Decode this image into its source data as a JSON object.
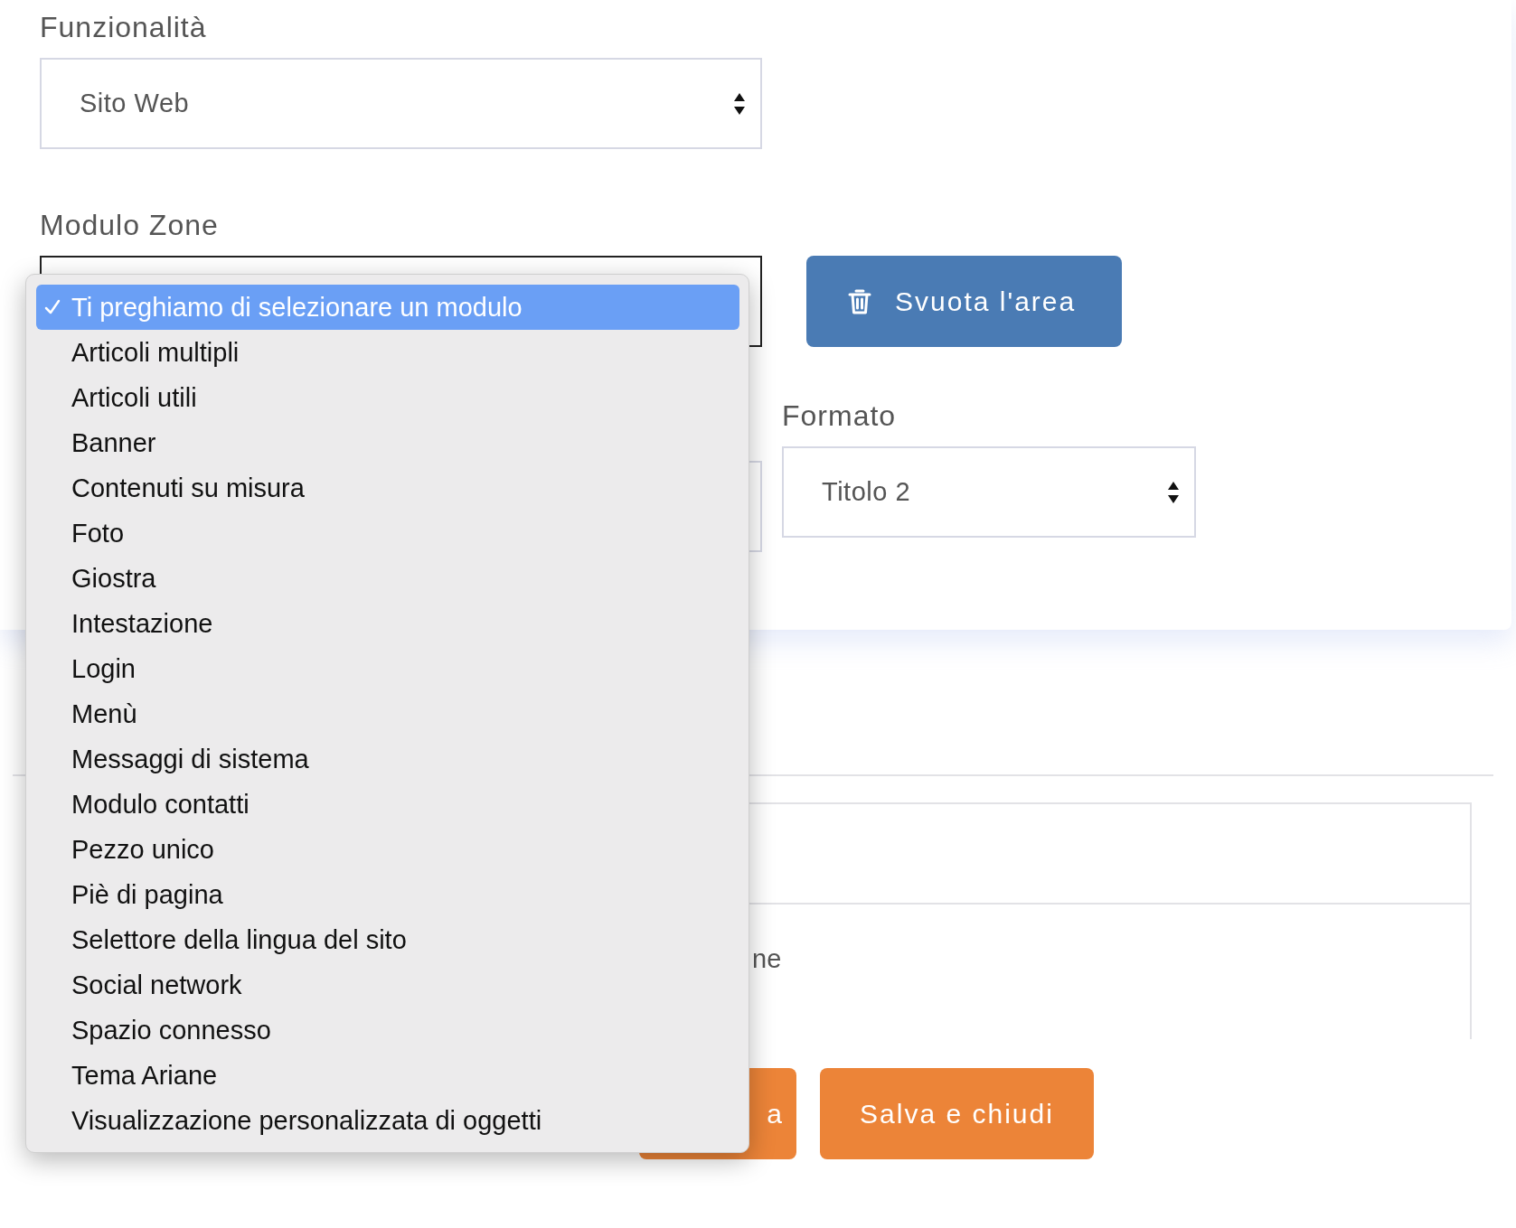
{
  "funzionalita": {
    "label": "Funzionalità",
    "value": "Sito Web"
  },
  "modulo_zone": {
    "label": "Modulo Zone",
    "options": [
      {
        "label": "Ti preghiamo di selezionare un modulo",
        "selected": true
      },
      {
        "label": "Articoli multipli",
        "selected": false
      },
      {
        "label": "Articoli utili",
        "selected": false
      },
      {
        "label": "Banner",
        "selected": false
      },
      {
        "label": "Contenuti su misura",
        "selected": false
      },
      {
        "label": "Foto",
        "selected": false
      },
      {
        "label": "Giostra",
        "selected": false
      },
      {
        "label": "Intestazione",
        "selected": false
      },
      {
        "label": "Login",
        "selected": false
      },
      {
        "label": "Menù",
        "selected": false
      },
      {
        "label": "Messaggi di sistema",
        "selected": false
      },
      {
        "label": "Modulo contatti",
        "selected": false
      },
      {
        "label": "Pezzo unico",
        "selected": false
      },
      {
        "label": "Piè di pagina",
        "selected": false
      },
      {
        "label": "Selettore della lingua del sito",
        "selected": false
      },
      {
        "label": "Social network",
        "selected": false
      },
      {
        "label": "Spazio connesso",
        "selected": false
      },
      {
        "label": "Tema Ariane",
        "selected": false
      },
      {
        "label": "Visualizzazione personalizzata di oggetti",
        "selected": false
      }
    ]
  },
  "clear_button": {
    "label": "Svuota l'area"
  },
  "formato": {
    "label": "Formato",
    "value": "Titolo 2"
  },
  "table": {
    "row_2_text": "ne"
  },
  "buttons": [
    {
      "label": "a"
    },
    {
      "label": "Salva e chiudi"
    }
  ]
}
